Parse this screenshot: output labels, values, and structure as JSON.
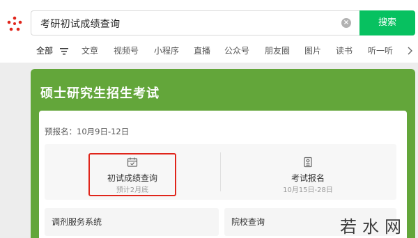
{
  "search": {
    "query": "考研初试成绩查询",
    "button_label": "搜索"
  },
  "tabs": [
    {
      "label": "全部",
      "active": true
    },
    {
      "label": "文章"
    },
    {
      "label": "视频号"
    },
    {
      "label": "小程序"
    },
    {
      "label": "直播"
    },
    {
      "label": "公众号"
    },
    {
      "label": "朋友圈"
    },
    {
      "label": "图片"
    },
    {
      "label": "读书"
    },
    {
      "label": "听一听"
    }
  ],
  "card": {
    "title": "硕士研究生招生考试",
    "prereg": "预报名：10月9日-12日",
    "items": [
      {
        "label": "初试成绩查询",
        "sub": "预计2月底",
        "icon": "calendar-icon"
      },
      {
        "label": "考试报名",
        "sub": "10月15日-28日",
        "icon": "document-icon"
      }
    ],
    "links": [
      {
        "label": "调剂服务系统"
      },
      {
        "label": "院校查询"
      }
    ]
  },
  "watermark": "若水网",
  "colors": {
    "accent": "#07c160",
    "card_green": "#63a63a",
    "highlight_red": "#e0251b"
  }
}
